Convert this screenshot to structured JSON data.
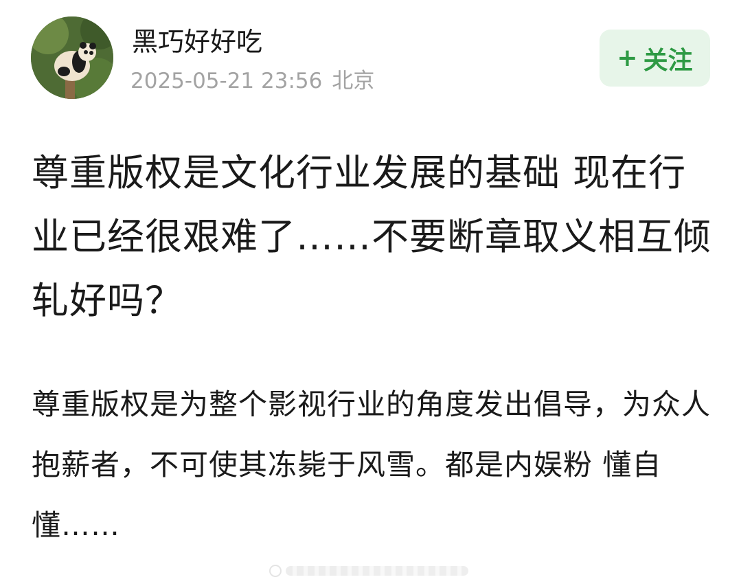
{
  "post": {
    "author": {
      "name": "黑巧好好吃",
      "avatar_icon": "panda-avatar-icon"
    },
    "meta": {
      "datetime": "2025-05-21 23:56",
      "location": "北京"
    },
    "follow": {
      "plus": "+",
      "label": "关注"
    },
    "title": "尊重版权是文化行业发展的基础 现在行业已经很艰难了……不要断章取义相互倾轧好吗？",
    "body": "尊重版权是为整个影视行业的角度发出倡导，为众人抱薪者，不可使其冻毙于风雪。都是内娱粉 懂自懂……"
  },
  "colors": {
    "accent": "#2e9a44",
    "follow_bg": "#e7f5e9",
    "meta_text": "#a3a3a3",
    "text": "#1a1a1a"
  }
}
